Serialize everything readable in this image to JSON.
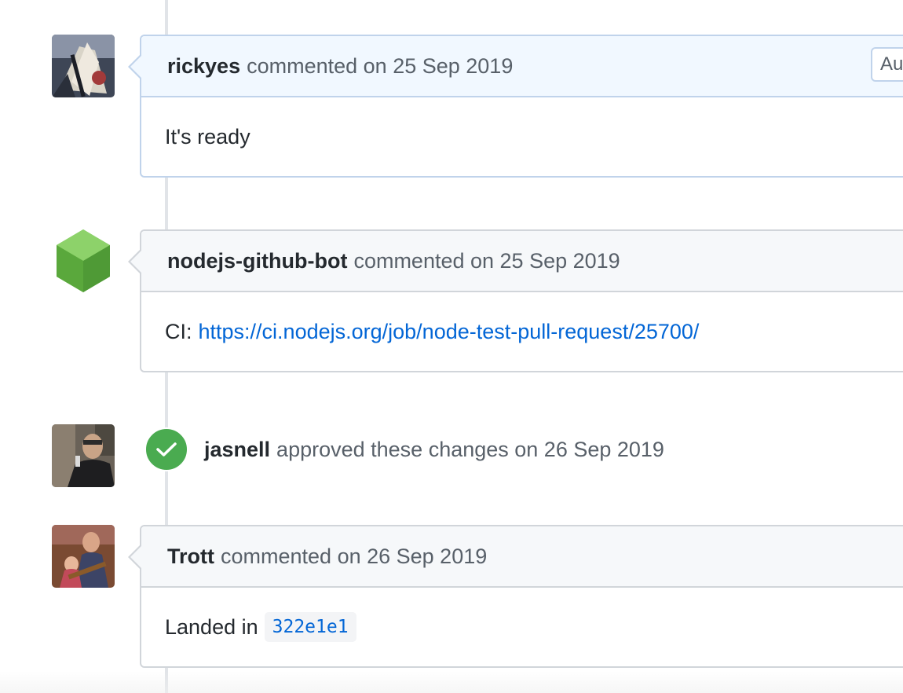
{
  "timeline": {
    "items": [
      {
        "type": "comment",
        "author": "rickyes",
        "action": "commented on 25 Sep 2019",
        "badge": "Aut",
        "body": "It's ready"
      },
      {
        "type": "comment",
        "author": "nodejs-github-bot",
        "action": "commented on 25 Sep 2019",
        "body_prefix": "CI:",
        "link": "https://ci.nodejs.org/job/node-test-pull-request/25700/"
      },
      {
        "type": "review",
        "author": "jasnell",
        "action": "approved these changes on 26 Sep 2019"
      },
      {
        "type": "comment",
        "author": "Trott",
        "action": "commented on 26 Sep 2019",
        "body_prefix": "Landed in",
        "commit": "322e1e1"
      }
    ]
  },
  "icons": {
    "review_icon": "check-icon",
    "bot_avatar": "nodejs-hexagon-icon"
  },
  "colors": {
    "link": "#0366d6",
    "approved": "#4aab50",
    "own_comment_header": "#f1f8ff",
    "comment_header": "#f6f8fa",
    "node_green": "#6cc24a"
  }
}
